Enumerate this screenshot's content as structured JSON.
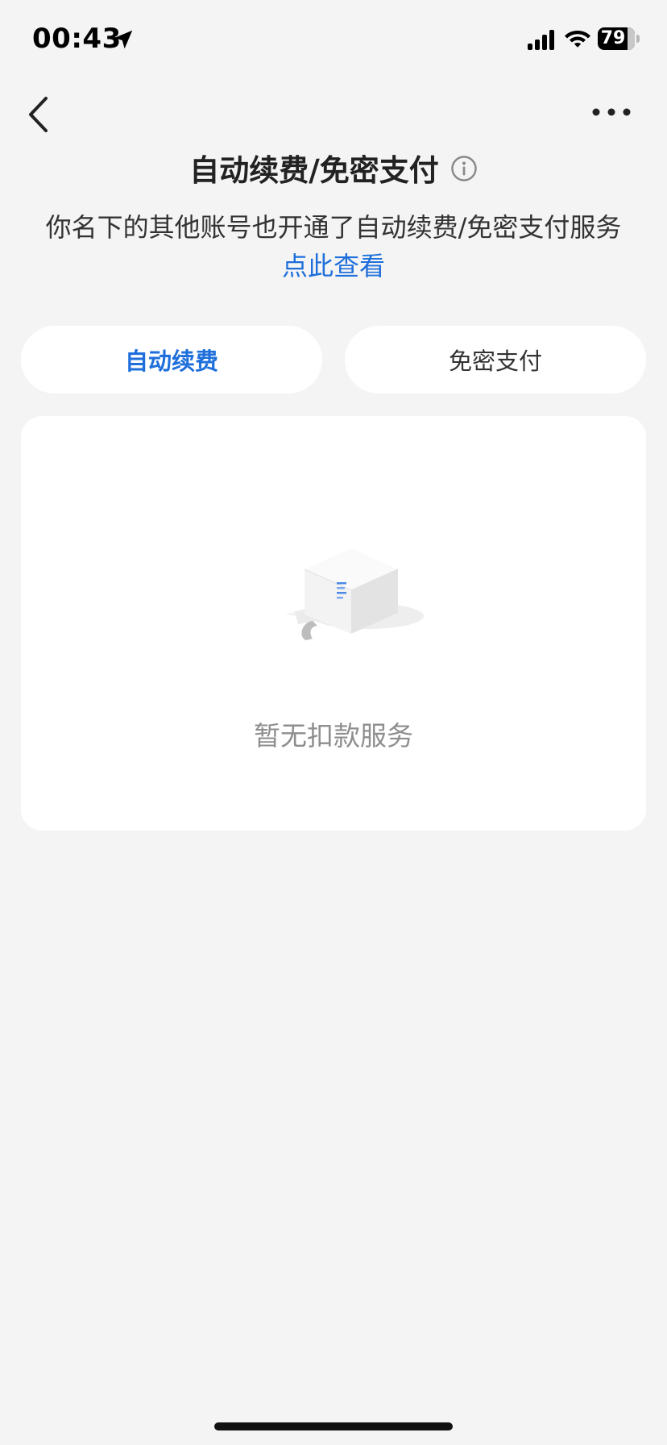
{
  "status_bar": {
    "time": "00:43",
    "battery_level": "79",
    "icons": [
      "location-arrow-icon",
      "cellular-signal-icon",
      "wifi-icon",
      "battery-icon"
    ]
  },
  "nav": {
    "back_icon": "chevron-left-icon",
    "more_icon": "ellipsis-icon",
    "title": "自动续费/免密支付",
    "info_icon": "info-circle-icon"
  },
  "notice": {
    "text": "你名下的其他账号也开通了自动续费/免密支付服务",
    "link": "点此查看"
  },
  "tabs": [
    {
      "label": "自动续费",
      "active": true
    },
    {
      "label": "免密支付",
      "active": false
    }
  ],
  "empty_state": {
    "illustration_icon": "empty-box-icon",
    "text": "暂无扣款服务"
  },
  "colors": {
    "accent": "#1e6fdb",
    "background": "#f4f4f4",
    "card": "#ffffff",
    "muted_text": "#8e8e8e"
  }
}
